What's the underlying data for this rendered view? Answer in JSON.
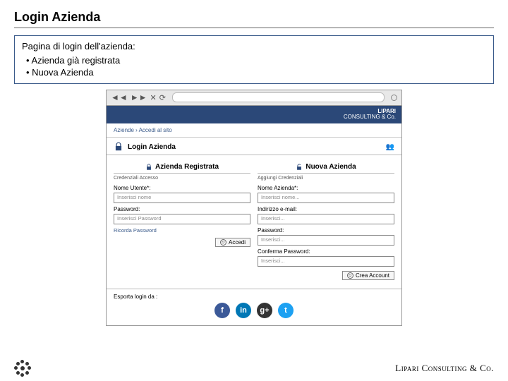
{
  "slide": {
    "title": "Login Azienda",
    "description_lead": "Pagina di login dell'azienda:",
    "description_items": [
      "Azienda già registrata",
      "Nuova Azienda"
    ]
  },
  "browser": {
    "back": "◄◄",
    "fwd": "►►",
    "stop": "✕",
    "reload": "⟳"
  },
  "brand": {
    "name": "LIPARI",
    "tagline": "CONSULTING & Co."
  },
  "crumb": {
    "root": "Aziende",
    "sep": " › ",
    "current": "Accedi al sito"
  },
  "header": {
    "title": "Login Azienda"
  },
  "forms": {
    "left": {
      "title": "Azienda Registrata",
      "subtitle": "Credenziali Accesso",
      "user_label": "Nome Utente*:",
      "user_placeholder": "Inserisci nome",
      "pass_label": "Password:",
      "pass_placeholder": "Inserisci Password",
      "forgot": "Ricorda Password",
      "submit": "Accedi"
    },
    "right": {
      "title": "Nuova Azienda",
      "subtitle": "Aggiungi Credenziali",
      "name_label": "Nome Azienda*:",
      "name_placeholder": "Inserisci nome...",
      "email_label": "Indirizzo e-mail:",
      "email_placeholder": "Inserisci...",
      "pass_label": "Password:",
      "pass_placeholder": "Inserisci...",
      "conf_label": "Conferma Password:",
      "conf_placeholder": "Inserisci...",
      "submit": "Crea Account"
    }
  },
  "social": {
    "label": "Esporta login da :",
    "items": [
      "f",
      "in",
      "g+",
      "t"
    ]
  },
  "footer": {
    "brand": "Lipari Consulting & Co."
  }
}
